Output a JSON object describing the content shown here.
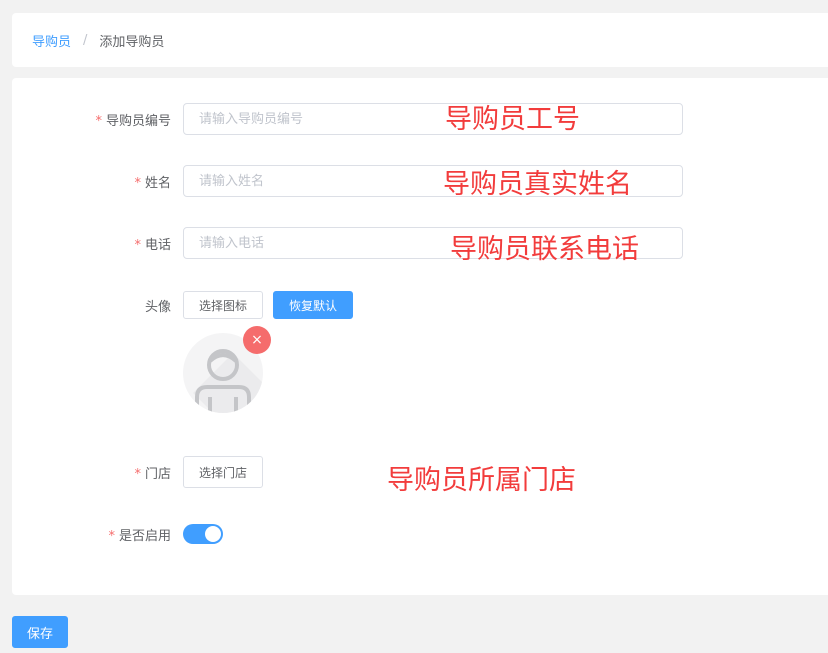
{
  "breadcrumb": {
    "parent": "导购员",
    "separator": "/",
    "current": "添加导购员"
  },
  "form": {
    "code": {
      "label": "导购员编号",
      "required": true,
      "value": "",
      "placeholder": "请输入导购员编号"
    },
    "name": {
      "label": "姓名",
      "required": true,
      "value": "",
      "placeholder": "请输入姓名"
    },
    "phone": {
      "label": "电话",
      "required": true,
      "value": "",
      "placeholder": "请输入电话"
    },
    "avatar": {
      "label": "头像",
      "choose_label": "选择图标",
      "reset_label": "恢复默认",
      "remove_icon": "close-icon"
    },
    "store": {
      "label": "门店",
      "required": true,
      "choose_label": "选择门店"
    },
    "enabled": {
      "label": "是否启用",
      "required": true,
      "value": true
    }
  },
  "annotations": {
    "code": "导购员工号",
    "name": "导购员真实姓名",
    "phone": "导购员联系电话",
    "store": "导购员所属门店"
  },
  "save_label": "保存",
  "colors": {
    "primary": "#409eff",
    "required": "#f56c6c",
    "annotation": "#f23c3c"
  }
}
